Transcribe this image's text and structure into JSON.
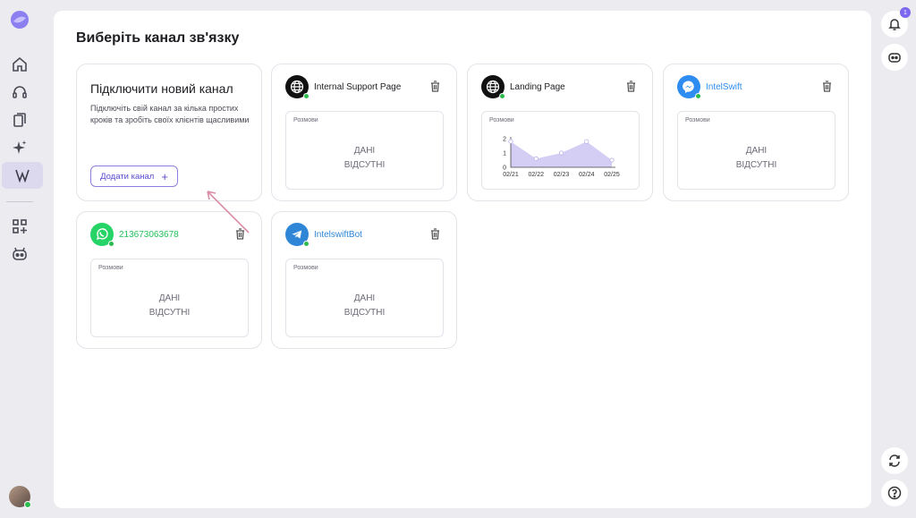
{
  "page": {
    "title": "Виберіть канал зв'язку"
  },
  "notifications": {
    "count": "1"
  },
  "new_channel": {
    "title": "Підключити новий канал",
    "description": "Підключіть свій канал за кілька простих кроків та зробіть своїх клієнтів щасливими",
    "button_label": "Додати канал"
  },
  "channels": [
    {
      "name": "Internal Support Page",
      "type": "web",
      "chart_label": "Розмови",
      "empty": [
        "ДАНІ",
        "ВІДСУТНІ"
      ]
    },
    {
      "name": "Landing Page",
      "type": "web",
      "chart_label": "Розмови"
    },
    {
      "name": "IntelSwift",
      "type": "messenger",
      "chart_label": "Розмови",
      "empty": [
        "ДАНІ",
        "ВІДСУТНІ"
      ]
    },
    {
      "name": "213673063678",
      "type": "whatsapp",
      "chart_label": "Розмови",
      "empty": [
        "ДАНІ",
        "ВІДСУТНІ"
      ]
    },
    {
      "name": "IntelswiftBot",
      "type": "telegram",
      "chart_label": "Розмови",
      "empty": [
        "ДАНІ",
        "ВІДСУТНІ"
      ]
    }
  ],
  "chart_data": {
    "type": "area",
    "x": [
      "02/21",
      "02/22",
      "02/23",
      "02/24",
      "02/25"
    ],
    "yticks": [
      "0",
      "1",
      "2"
    ],
    "ylim": [
      0,
      2
    ],
    "values": [
      1.8,
      0.6,
      1.0,
      1.8,
      0.5
    ],
    "color": "#c5bdf0"
  },
  "colors": {
    "accent": "#7b68ee",
    "online": "#2dbb4f",
    "whatsapp": "#25d366",
    "telegram": "#2f86d6",
    "messenger": "#2f8cf0"
  }
}
